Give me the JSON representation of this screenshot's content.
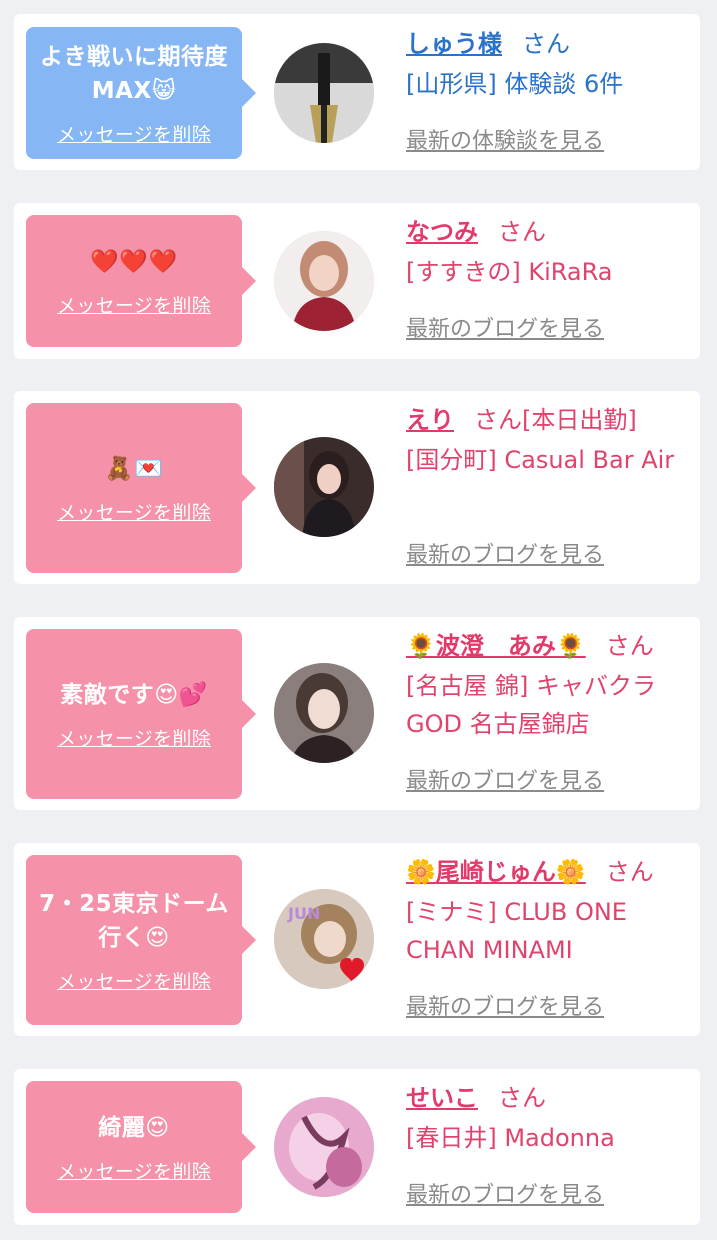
{
  "colors": {
    "bubble_blue": "#86b6f4",
    "bubble_pink": "#f591a8",
    "link_blue": "#2a73c9",
    "link_pink": "#e0446d",
    "gray_link": "#8a8a8a"
  },
  "cards": [
    {
      "message": "よき戦いに期待度MAX😸",
      "delete_label": "メッセージを削除",
      "name": "しゅう様",
      "honorific": "さん",
      "shop": "[山形県] 体験談 6件",
      "latest_label": "最新の体験談を見る"
    },
    {
      "message": "❤️❤️❤️",
      "delete_label": "メッセージを削除",
      "name": "なつみ",
      "honorific": "さん",
      "shop": "[すすきの] KiRaRa",
      "latest_label": "最新のブログを見る"
    },
    {
      "message": "🧸💌",
      "delete_label": "メッセージを削除",
      "name": "えり",
      "honorific": "さん[本日出勤]",
      "shop": "[国分町] Casual Bar Air",
      "latest_label": "最新のブログを見る"
    },
    {
      "message": "素敵です😍💕",
      "delete_label": "メッセージを削除",
      "name": "🌻波澄　あみ🌻",
      "honorific": "さん",
      "shop": "[名古屋 錦] キャバクラGOD 名古屋錦店",
      "latest_label": "最新のブログを見る"
    },
    {
      "message": "7・25東京ドーム行く😍",
      "delete_label": "メッセージを削除",
      "name": "🌼尾崎じゅん🌼",
      "honorific": "さん",
      "shop": "[ミナミ] CLUB ONE CHAN MINAMI",
      "latest_label": "最新のブログを見る"
    },
    {
      "message": "綺麗😍",
      "delete_label": "メッセージを削除",
      "name": "せいこ",
      "honorific": "さん",
      "shop": "[春日井] Madonna",
      "latest_label": "最新のブログを見る"
    }
  ],
  "avatar_text": "JUN"
}
